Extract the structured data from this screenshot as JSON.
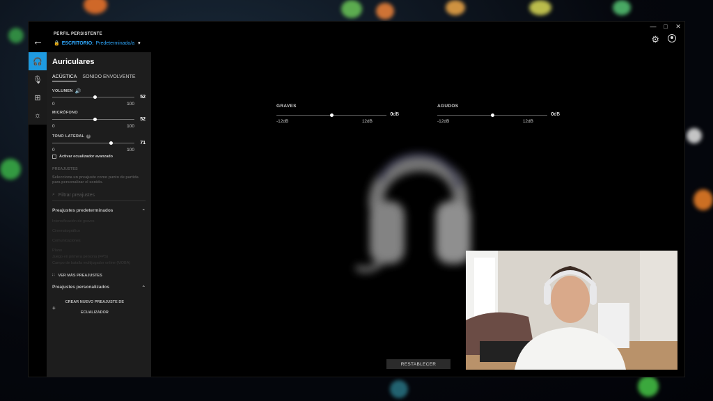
{
  "window": {
    "profile_label": "PERFIL PERSISTENTE",
    "profile_kind": "ESCRITORIO:",
    "profile_value": "Predeterminado/a"
  },
  "panel": {
    "title": "Auriculares",
    "tabs": [
      {
        "label": "ACÚSTICA",
        "active": true
      },
      {
        "label": "SONIDO ENVOLVENTE",
        "active": false
      }
    ],
    "volume": {
      "label": "VOLUMEN",
      "value": "52",
      "min": "0",
      "max": "100",
      "level": 52
    },
    "mic": {
      "label": "MICRÓFONO",
      "value": "52",
      "min": "0",
      "max": "100",
      "level": 52
    },
    "sidetone": {
      "label": "TONO LATERAL",
      "help": "?",
      "value": "71",
      "min": "0",
      "max": "100",
      "level": 71
    },
    "advanced_eq_label": "Activar ecualizador avanzado",
    "presets_heading": "PREAJUSTES",
    "presets_description": "Selecciona un preajuste como punto de partida para personalizar el sonido.",
    "filter_placeholder": "Filtrar preajustes",
    "default_presets_heading": "Preajustes predeterminados",
    "default_presets": [
      "Intensificación de graves",
      "Cinematográfico",
      "Comunicaciones",
      "Plano",
      "Juego en primera persona (FPS)",
      "Campo de batalla multijugador online (MOBA)"
    ],
    "more_presets_label": "VER MÁS PREAJUSTES",
    "custom_presets_heading": "Preajustes personalizados",
    "create_preset_label_1": "CREAR NUEVO PREAJUSTE DE",
    "create_preset_label_2": "ECUALIZADOR"
  },
  "eq": {
    "bass": {
      "label": "GRAVES",
      "value": "0",
      "unit": "dB",
      "min": "-12dB",
      "max": "12dB",
      "level": 50
    },
    "treble": {
      "label": "AGUDOS",
      "value": "0",
      "unit": "dB",
      "min": "-12dB",
      "max": "12dB",
      "level": 50
    }
  },
  "reset_label": "RESTABLECER",
  "colors": {
    "accent": "#1e9ae0",
    "profile_link": "#2fa9ff",
    "panel_bg": "#1d1d1d"
  }
}
